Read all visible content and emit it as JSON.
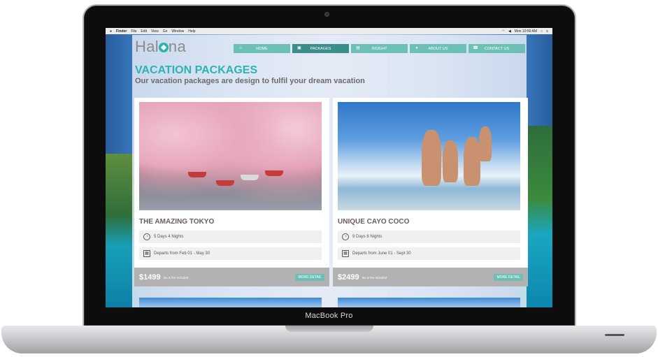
{
  "device": {
    "label": "MacBook Pro"
  },
  "menubar": {
    "app": "Finder",
    "items": [
      "File",
      "Edit",
      "View",
      "Go",
      "Window",
      "Help"
    ],
    "clock": "Mon 10:50 AM"
  },
  "site": {
    "logo": {
      "prefix": "Hal",
      "suffix": "na"
    },
    "nav": [
      {
        "label": "HOME",
        "icon": "home-icon",
        "glyph": "⌂"
      },
      {
        "label": "PACKAGES",
        "icon": "gift-icon",
        "glyph": "▣"
      },
      {
        "label": "INSIGHT",
        "icon": "id-card-icon",
        "glyph": "▤"
      },
      {
        "label": "ABOUT US",
        "icon": "person-icon",
        "glyph": "●"
      },
      {
        "label": "CONTACT US",
        "icon": "phone-icon",
        "glyph": "☎"
      }
    ],
    "heading": "VACATION PACKAGES",
    "subheading": "Our vacation packages are design to fulfil your dream vacation"
  },
  "cards": [
    {
      "title": "THE AMAZING TOKYO",
      "duration": "5 Days 4 Nights",
      "departs": "Departs from Feb 01 - May 30",
      "price": "$1499",
      "tax_note": "tax & fee included",
      "button": "MORE DETAIL"
    },
    {
      "title": "UNIQUE CAYO COCO",
      "duration": "9 Days 8 Nights",
      "departs": "Departs from June 01 - Sept 30",
      "price": "$2499",
      "tax_note": "tax & fee included",
      "button": "MORE DETAIL"
    }
  ],
  "colors": {
    "accent": "#2bb3b0",
    "nav": "#6cc0b5",
    "nav_active": "#3a8f8b",
    "price_bar": "#b2b2b2"
  }
}
